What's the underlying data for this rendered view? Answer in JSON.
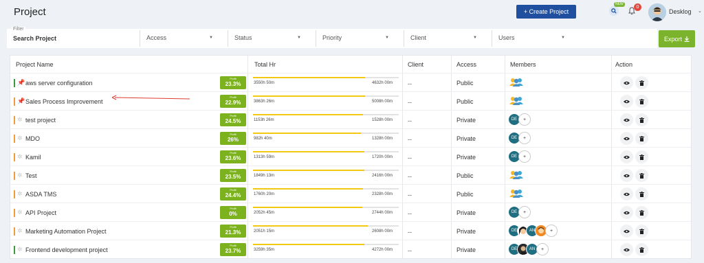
{
  "header": {
    "title": "Project",
    "create_button": "+ Create Project",
    "new_badge": "NEW",
    "notification_count": "0",
    "user_name": "Desklog"
  },
  "filters": {
    "label": "Filter",
    "search_value": "Search Project",
    "selects": [
      {
        "label": "Access"
      },
      {
        "label": "Status"
      },
      {
        "label": "Priority"
      },
      {
        "label": "Client"
      },
      {
        "label": "Users"
      }
    ],
    "export_label": "Export"
  },
  "table": {
    "columns": {
      "project_name": "Project Name",
      "total_hr": "Total Hr",
      "client": "Client",
      "access": "Access",
      "members": "Members",
      "action": "Action"
    },
    "profit_caption": "Profit",
    "rows": [
      {
        "name": "aws server configuration",
        "pinned": true,
        "status_color": "#3c9a3c",
        "profit": "23.3%",
        "spent": "3550h 50m",
        "total": "4632h 00m",
        "progress": 0.77,
        "client": "--",
        "access": "Public",
        "members": {
          "type": "group"
        }
      },
      {
        "name": "Sales Process Improvement",
        "pinned": true,
        "status_color": "#f29b3c",
        "profit": "22.9%",
        "spent": "3863h 26m",
        "total": "5008h 00m",
        "progress": 0.77,
        "client": "--",
        "access": "Public",
        "members": {
          "type": "group"
        }
      },
      {
        "name": "test project",
        "pinned": false,
        "status_color": "#f29b3c",
        "profit": "24.5%",
        "spent": "1153h 26m",
        "total": "1528h 00m",
        "progress": 0.755,
        "client": "--",
        "access": "Private",
        "members": {
          "type": "list",
          "avatars": [
            "DE"
          ]
        }
      },
      {
        "name": "MDO",
        "pinned": false,
        "status_color": "#f29b3c",
        "profit": "26%",
        "spent": "982h 40m",
        "total": "1328h 00m",
        "progress": 0.74,
        "client": "--",
        "access": "Private",
        "members": {
          "type": "list",
          "avatars": [
            "DE"
          ]
        }
      },
      {
        "name": "Kamil",
        "pinned": false,
        "status_color": "#f29b3c",
        "profit": "23.6%",
        "spent": "1313h 59m",
        "total": "1720h 00m",
        "progress": 0.764,
        "client": "--",
        "access": "Private",
        "members": {
          "type": "list",
          "avatars": [
            "DE"
          ]
        }
      },
      {
        "name": "Test",
        "pinned": false,
        "status_color": "#f29b3c",
        "profit": "23.5%",
        "spent": "1849h 13m",
        "total": "2416h 00m",
        "progress": 0.765,
        "client": "--",
        "access": "Public",
        "members": {
          "type": "group"
        }
      },
      {
        "name": "ASDA TMS",
        "pinned": false,
        "status_color": "#f29b3c",
        "profit": "24.4%",
        "spent": "1760h 20m",
        "total": "2328h 00m",
        "progress": 0.756,
        "client": "--",
        "access": "Public",
        "members": {
          "type": "group"
        }
      },
      {
        "name": "API Project",
        "pinned": false,
        "status_color": "#f29b3c",
        "profit": "0%",
        "spent": "2052h 45m",
        "total": "2744h 00m",
        "progress": 0.748,
        "client": "--",
        "access": "Private",
        "members": {
          "type": "list",
          "avatars": [
            "DE"
          ]
        }
      },
      {
        "name": "Marketing Automation Project",
        "pinned": false,
        "status_color": "#f29b3c",
        "profit": "21.3%",
        "spent": "2051h 15m",
        "total": "2608h 00m",
        "progress": 0.787,
        "client": "--",
        "access": "Private",
        "members": {
          "type": "list",
          "avatars": [
            "DE",
            "face",
            "AN",
            "orange"
          ]
        }
      },
      {
        "name": "Frontend development project",
        "pinned": false,
        "status_color": "#3c9a3c",
        "profit": "23.7%",
        "spent": "3259h 35m",
        "total": "4272h 00m",
        "progress": 0.763,
        "client": "--",
        "access": "Private",
        "members": {
          "type": "list",
          "avatars": [
            "DE",
            "dark",
            "AN"
          ]
        }
      }
    ]
  },
  "colors": {
    "primary": "#1f4f9e",
    "export_green": "#7cb32c",
    "profit_green": "#7bb21d",
    "progress_yellow": "#f2c811",
    "annotation_red": "#e03a2e"
  }
}
